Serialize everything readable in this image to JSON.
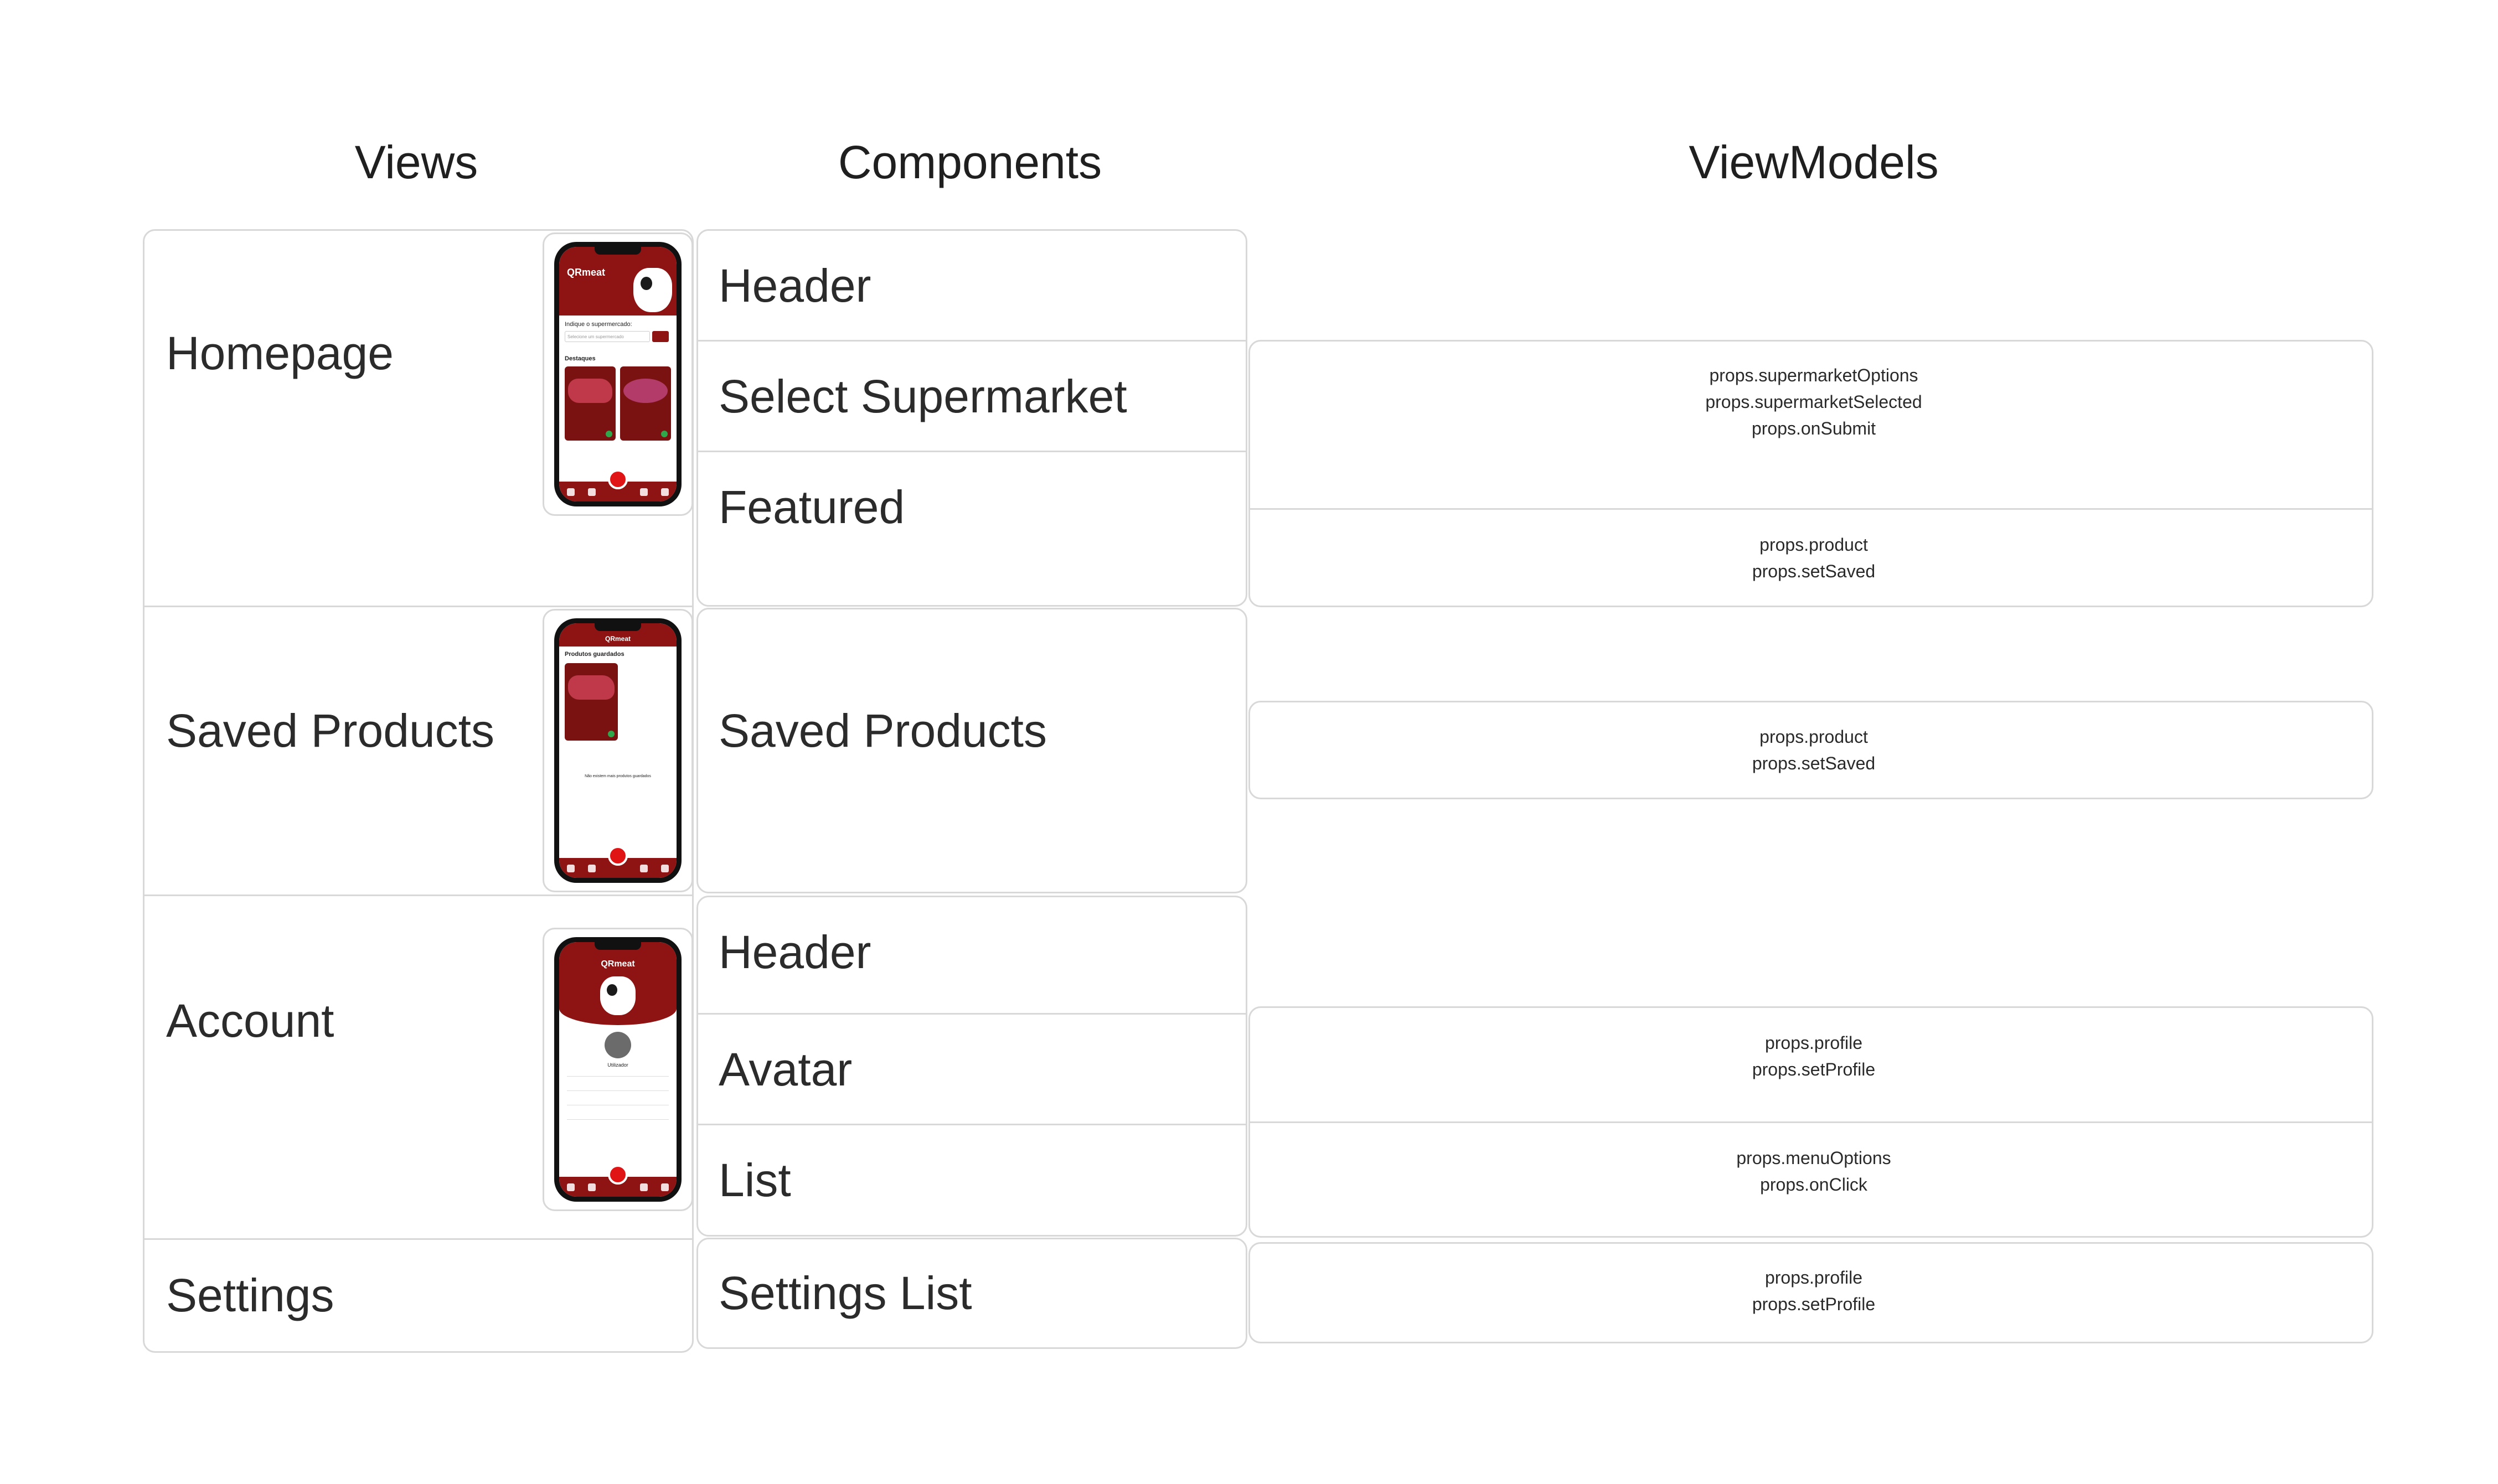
{
  "columns": {
    "views": "Views",
    "components": "Components",
    "viewmodels": "ViewModels"
  },
  "views": {
    "homepage": "Homepage",
    "saved_products": "Saved Products",
    "account": "Account",
    "settings": "Settings"
  },
  "components": {
    "home_header": "Header",
    "home_select_supermarket": "Select Supermarket",
    "home_featured": "Featured",
    "saved_products": "Saved Products",
    "account_header": "Header",
    "account_avatar": "Avatar",
    "account_list": "List",
    "settings_list": "Settings List"
  },
  "viewmodels": {
    "select_supermarket": [
      "props.supermarketOptions",
      "props.supermarketSelected",
      "props.onSubmit"
    ],
    "featured": [
      "props.product",
      "props.setSaved"
    ],
    "saved_products": [
      "props.product",
      "props.setSaved"
    ],
    "avatar": [
      "props.profile",
      "props.setProfile"
    ],
    "list": [
      "props.menuOptions",
      "props.onClick"
    ],
    "settings_list": [
      "props.profile",
      "props.setProfile"
    ]
  },
  "mockups": {
    "app_name": "QRmeat",
    "home_prompt": "Indique o supermercado:",
    "home_select_placeholder": "Selecione um supermercado",
    "home_section": "Destaques",
    "saved_title": "Produtos guardados",
    "saved_empty": "Não existem mais produtos guardados",
    "account_user": "Utilizador"
  },
  "colors": {
    "brand_red": "#8e1414",
    "border": "#d8d8d8",
    "text": "#1f1f1f"
  }
}
